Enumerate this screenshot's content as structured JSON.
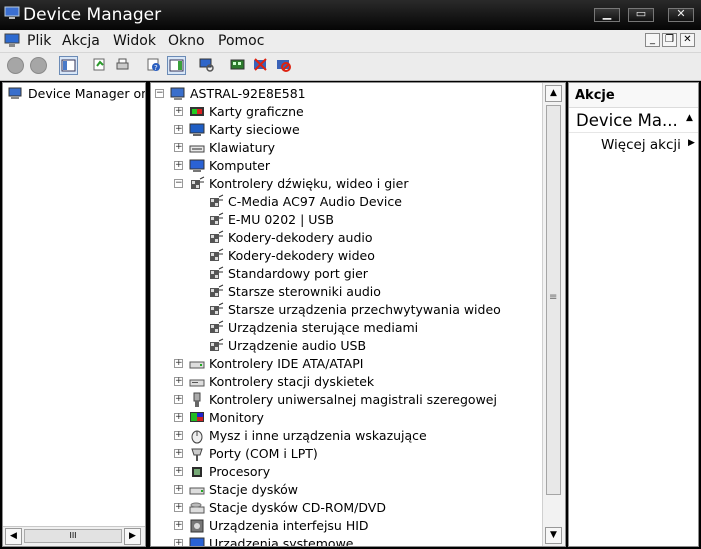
{
  "window": {
    "title": "Device Manager"
  },
  "menu": {
    "items": [
      "Plik",
      "Akcja",
      "Widok",
      "Okno",
      "Pomoc"
    ]
  },
  "left_pane": {
    "root_label": "Device Manager on l"
  },
  "tree": {
    "root": "ASTRAL-92E8E581",
    "items": [
      {
        "label": "Karty graficzne",
        "level": 1,
        "expander": "+",
        "icon": "display-adapter-icon"
      },
      {
        "label": "Karty sieciowe",
        "level": 1,
        "expander": "+",
        "icon": "network-adapter-icon"
      },
      {
        "label": "Klawiatury",
        "level": 1,
        "expander": "+",
        "icon": "keyboard-icon"
      },
      {
        "label": "Komputer",
        "level": 1,
        "expander": "+",
        "icon": "computer-icon"
      },
      {
        "label": "Kontrolery dźwięku, wideo i gier",
        "level": 1,
        "expander": "-",
        "icon": "sound-icon"
      },
      {
        "label": "C-Media AC97 Audio Device",
        "level": 2,
        "expander": "",
        "icon": "sound-icon"
      },
      {
        "label": "E-MU 0202 | USB",
        "level": 2,
        "expander": "",
        "icon": "sound-icon"
      },
      {
        "label": "Kodery-dekodery audio",
        "level": 2,
        "expander": "",
        "icon": "sound-icon"
      },
      {
        "label": "Kodery-dekodery wideo",
        "level": 2,
        "expander": "",
        "icon": "sound-icon"
      },
      {
        "label": "Standardowy port gier",
        "level": 2,
        "expander": "",
        "icon": "sound-icon"
      },
      {
        "label": "Starsze sterowniki audio",
        "level": 2,
        "expander": "",
        "icon": "sound-icon"
      },
      {
        "label": "Starsze urządzenia przechwytywania wideo",
        "level": 2,
        "expander": "",
        "icon": "sound-icon"
      },
      {
        "label": "Urządzenia sterujące mediami",
        "level": 2,
        "expander": "",
        "icon": "sound-icon"
      },
      {
        "label": "Urządzenie audio USB",
        "level": 2,
        "expander": "",
        "icon": "sound-icon"
      },
      {
        "label": "Kontrolery IDE ATA/ATAPI",
        "level": 1,
        "expander": "+",
        "icon": "ide-controller-icon"
      },
      {
        "label": "Kontrolery stacji dyskietek",
        "level": 1,
        "expander": "+",
        "icon": "floppy-controller-icon"
      },
      {
        "label": "Kontrolery uniwersalnej magistrali szeregowej",
        "level": 1,
        "expander": "+",
        "icon": "usb-icon"
      },
      {
        "label": "Monitory",
        "level": 1,
        "expander": "+",
        "icon": "monitor-icon"
      },
      {
        "label": "Mysz i inne urządzenia wskazujące",
        "level": 1,
        "expander": "+",
        "icon": "mouse-icon"
      },
      {
        "label": "Porty (COM i LPT)",
        "level": 1,
        "expander": "+",
        "icon": "port-icon"
      },
      {
        "label": "Procesory",
        "level": 1,
        "expander": "+",
        "icon": "processor-icon"
      },
      {
        "label": "Stacje dysków",
        "level": 1,
        "expander": "+",
        "icon": "disk-drive-icon"
      },
      {
        "label": "Stacje dysków CD-ROM/DVD",
        "level": 1,
        "expander": "+",
        "icon": "cdrom-icon"
      },
      {
        "label": "Urządzenia interfejsu HID",
        "level": 1,
        "expander": "+",
        "icon": "hid-icon"
      },
      {
        "label": "Urządzenia systemowe",
        "level": 1,
        "expander": "+",
        "icon": "system-device-icon"
      }
    ]
  },
  "actions": {
    "header": "Akcje",
    "section": "Device Ma...",
    "more": "Więcej akcji"
  },
  "colors": {
    "title_bg": "#0a0a0a",
    "selection": "#d8e6f7"
  }
}
